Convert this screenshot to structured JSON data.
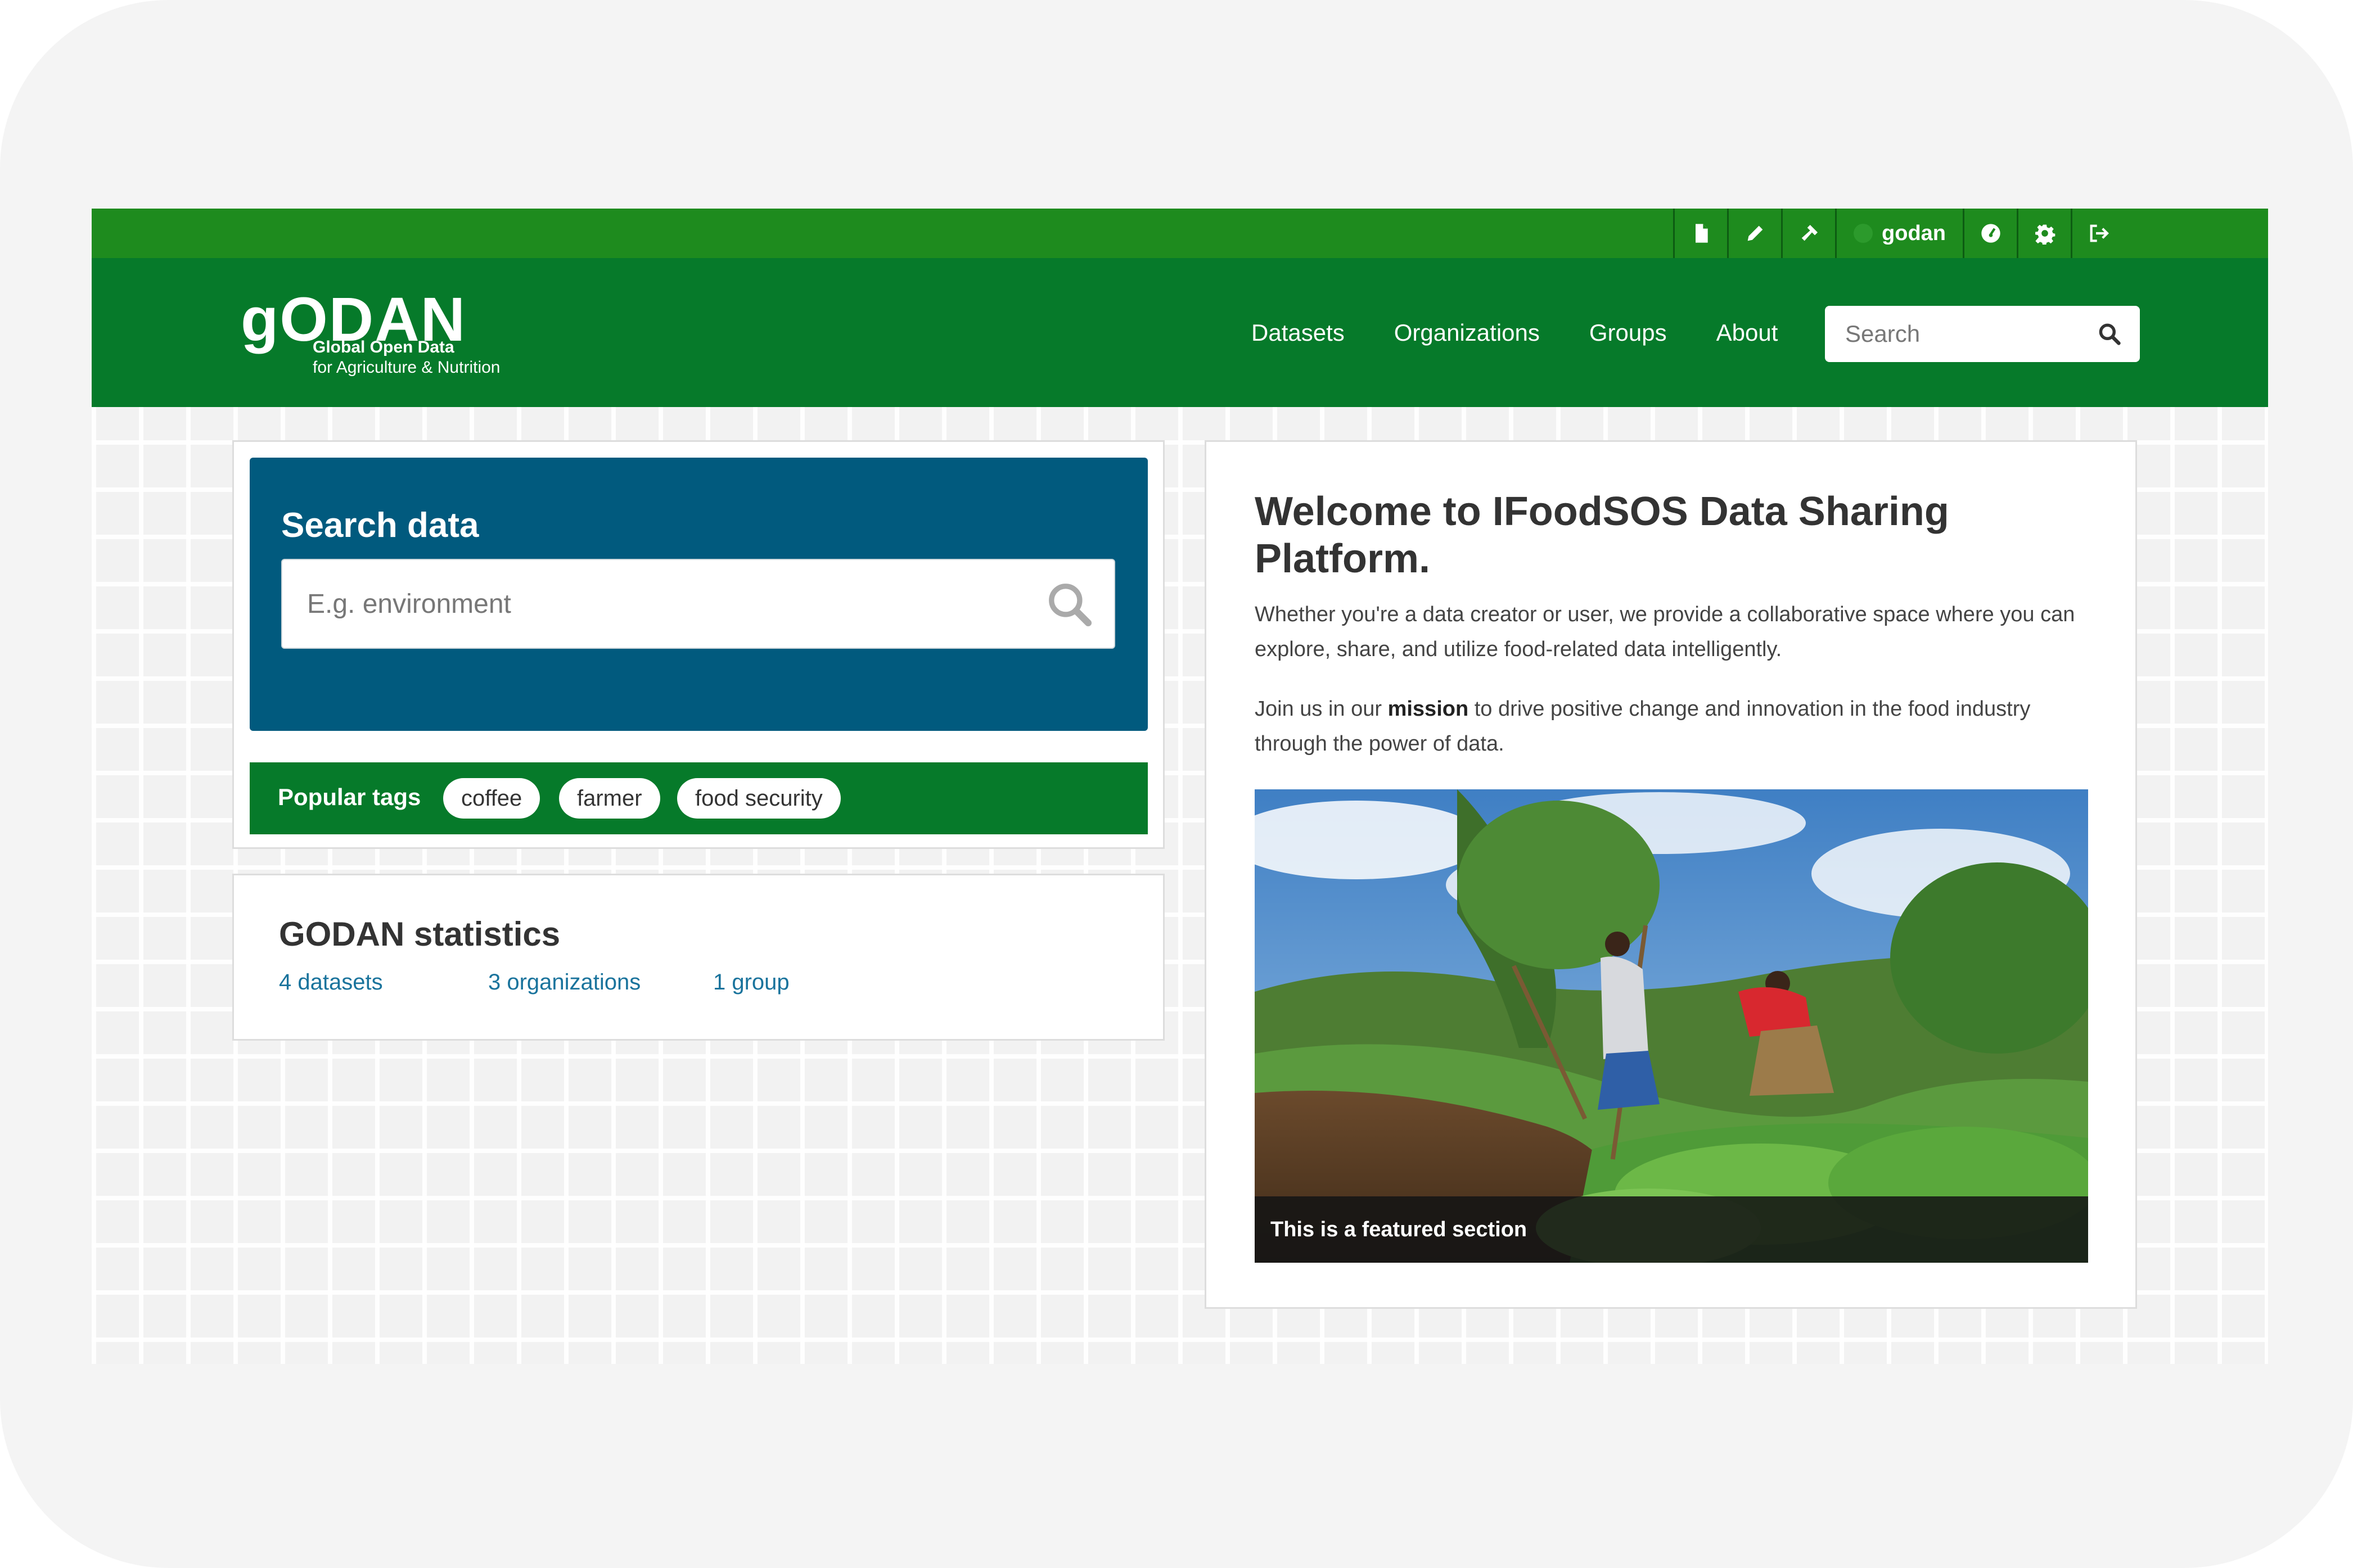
{
  "topbar": {
    "username": "godan",
    "icons": [
      "file-icon",
      "pencil-icon",
      "hammer-icon",
      "avatar-icon",
      "dashboard-icon",
      "gear-icon",
      "logout-icon"
    ]
  },
  "header": {
    "logo": {
      "main": "gODAN",
      "line1": "Global Open Data",
      "line2": "for Agriculture & Nutrition"
    },
    "nav": [
      "Datasets",
      "Organizations",
      "Groups",
      "About"
    ],
    "search_placeholder": "Search"
  },
  "search_data": {
    "title": "Search data",
    "placeholder": "E.g. environment"
  },
  "popular_tags": {
    "label": "Popular tags",
    "tags": [
      "coffee",
      "farmer",
      "food security"
    ]
  },
  "stats": {
    "title": "GODAN statistics",
    "datasets": "4 datasets",
    "organizations": "3 organizations",
    "groups": "1 group"
  },
  "welcome": {
    "title": "Welcome to IFoodSOS Data Sharing Platform.",
    "para1": "Whether you're a data creator or user, we provide a collaborative space where you can explore, share, and utilize food-related data intelligently.",
    "para2_before": "Join us in our ",
    "para2_bold": "mission",
    "para2_after": " to drive positive change and innovation in the food industry through the power of data.",
    "caption": "This is a featured section"
  },
  "colors": {
    "topbar": "#1e8b1e",
    "header": "#067a2a",
    "search_panel": "#015a7e",
    "link": "#19739c"
  }
}
